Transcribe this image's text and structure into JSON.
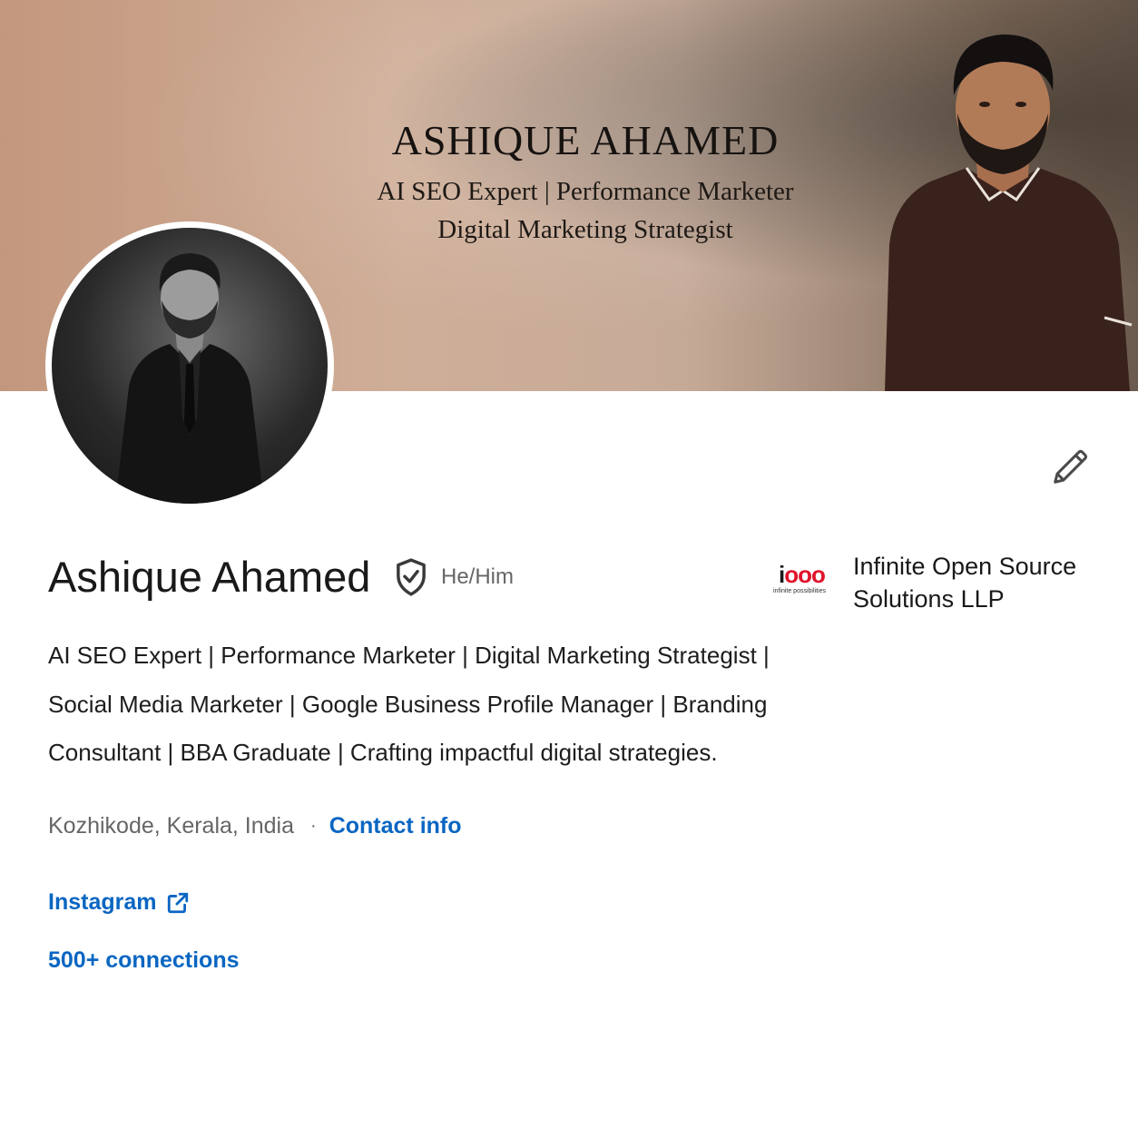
{
  "banner": {
    "title": "ASHIQUE AHAMED",
    "subtitle_line1": "AI SEO Expert | Performance Marketer",
    "subtitle_line2": "Digital Marketing Strategist"
  },
  "profile": {
    "name": "Ashique Ahamed",
    "pronouns": "He/Him",
    "headline": "AI SEO Expert | Performance Marketer | Digital Marketing Strategist | Social Media Marketer | Google Business Profile Manager | Branding Consultant | BBA Graduate | Crafting impactful digital strategies.",
    "location": "Kozhikode, Kerala, India",
    "separator": "·",
    "contact_info_label": "Contact info",
    "website_label": "Instagram",
    "connections_label": "500+ connections"
  },
  "company": {
    "logo_text": "iooo",
    "logo_tagline": "infinite possibilities",
    "name": "Infinite Open Source Solutions LLP"
  },
  "icons": {
    "verified": "shield-check-icon",
    "edit": "pencil-icon",
    "external_link": "external-link-icon"
  },
  "colors": {
    "link_blue": "#0a66c2",
    "muted_gray": "#666666",
    "logo_red": "#e0142b"
  }
}
